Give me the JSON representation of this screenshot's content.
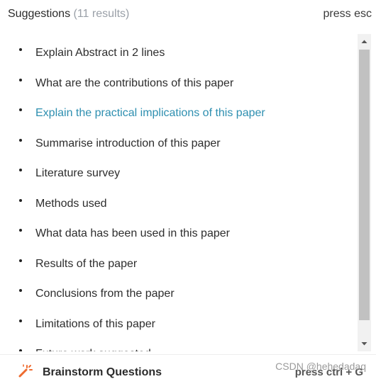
{
  "header": {
    "title": "Suggestions",
    "results_count": "(11 results)",
    "close_hint": "press esc"
  },
  "suggestions": [
    {
      "label": "Explain Abstract in 2 lines",
      "active": false
    },
    {
      "label": "What are the contributions of this paper",
      "active": false
    },
    {
      "label": "Explain the practical implications of this paper",
      "active": true
    },
    {
      "label": "Summarise introduction of this paper",
      "active": false
    },
    {
      "label": "Literature survey",
      "active": false
    },
    {
      "label": "Methods used",
      "active": false
    },
    {
      "label": "What data has been used in this paper",
      "active": false
    },
    {
      "label": "Results of the paper",
      "active": false
    },
    {
      "label": "Conclusions from the paper",
      "active": false
    },
    {
      "label": "Limitations of this paper",
      "active": false
    },
    {
      "label": "Future work suggested",
      "active": false
    }
  ],
  "footer": {
    "icon": "magic-wand-icon",
    "label": "Brainstorm Questions",
    "shortcut": "press ctrl + G"
  },
  "watermark": "CSDN @hehedadaq",
  "colors": {
    "accent": "#2e8fb0",
    "icon": "#ee6b2f"
  }
}
